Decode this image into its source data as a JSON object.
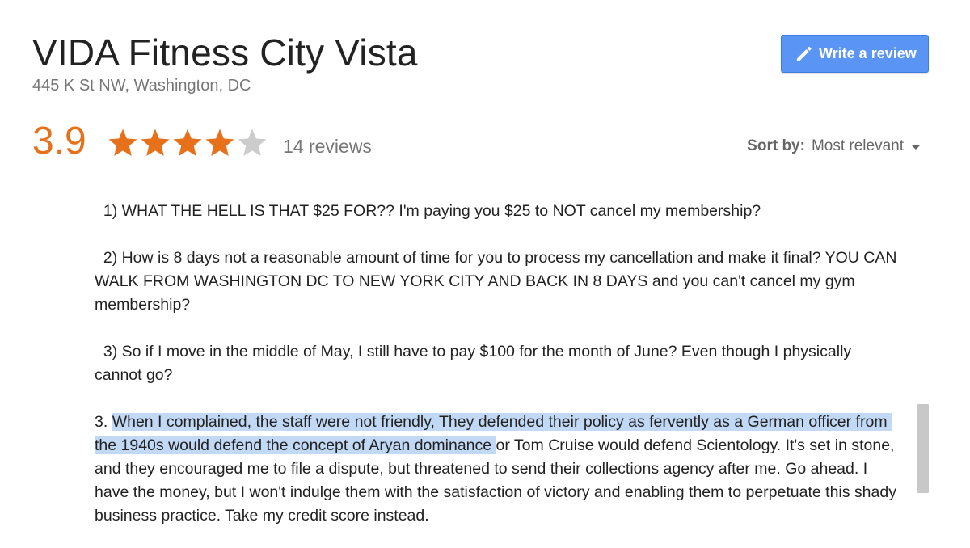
{
  "header": {
    "title": "VIDA Fitness City Vista",
    "address": "445 K St NW, Washington, DC"
  },
  "write_review_button": {
    "label": "Write a review"
  },
  "rating": {
    "value": "3.9",
    "stars_filled": 4,
    "stars_total": 5,
    "review_count": "14 reviews"
  },
  "sort": {
    "label": "Sort by:",
    "value": "Most relevant"
  },
  "review": {
    "p1": "  1) WHAT THE HELL IS THAT $25 FOR?? I'm paying you $25 to NOT cancel my membership?",
    "p2": "  2) How is 8 days not a reasonable amount of time for you to process my cancellation and make it final? YOU CAN WALK FROM WASHINGTON DC TO NEW YORK CITY AND BACK IN 8 DAYS and you can't cancel my gym membership?",
    "p3": "  3) So if I move in the middle of May, I still have to pay $100 for the month of June? Even though I physically cannot go?",
    "p4_prefix": "3. ",
    "p4_highlight": "When I complained, the staff were not friendly, They defended their policy as fervently as a German officer from the 1940s would defend the concept of Aryan dominance ",
    "p4_rest": "or Tom Cruise would defend Scientology. It's set in stone, and they encouraged me to file a dispute, but threatened to send their collections agency after me. Go ahead. I have the money, but I won't indulge them with the satisfaction of victory and enabling them to perpetuate this shady business practice. Take my credit score instead."
  },
  "colors": {
    "rating_orange": "#e7711b",
    "star_empty": "#cccccc",
    "button_blue": "#5a95f5",
    "highlight": "#c2d9f6",
    "muted_text": "#777777"
  }
}
